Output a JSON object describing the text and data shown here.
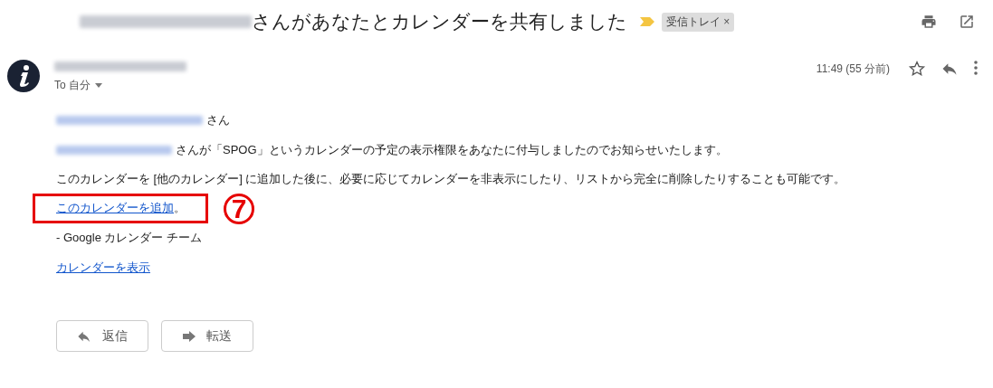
{
  "subject": {
    "text": "さんがあなたとカレンダーを共有しました",
    "label": "受信トレイ",
    "label_close": "×"
  },
  "message": {
    "to": "To 自分",
    "time": "11:49 (55 分前)"
  },
  "body": {
    "greeting": "さん",
    "line_1": "さんが「SPOG」というカレンダーの予定の表示権限をあなたに付与しましたのでお知らせいたします。",
    "line_2": "このカレンダーを [他のカレンダー] に追加した後に、必要に応じてカレンダーを非表示にしたり、リストから完全に削除したりすることも可能です。",
    "add_link": "このカレンダーを追加",
    "add_link_tail": "。",
    "signature": "- Google カレンダー チーム",
    "view_link": "カレンダーを表示"
  },
  "callout": {
    "number": "7"
  },
  "buttons": [
    {
      "kind": "reply",
      "label": "返信"
    },
    {
      "kind": "forward",
      "label": "転送"
    }
  ]
}
